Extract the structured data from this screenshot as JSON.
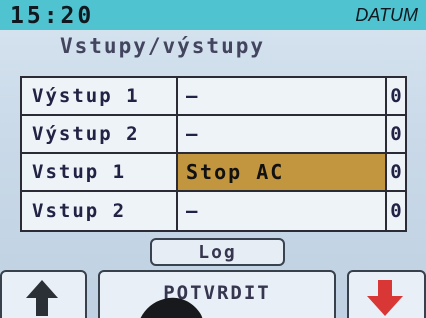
{
  "status_bar": {
    "time": "15:20",
    "date_label": "DATUM"
  },
  "page_title": "Vstupy/výstupy",
  "io_table": {
    "rows": [
      {
        "name": "Výstup 1",
        "value": "—",
        "count": "0",
        "active": false
      },
      {
        "name": "Výstup 2",
        "value": "—",
        "count": "0",
        "active": false
      },
      {
        "name": "Vstup 1",
        "value": "Stop AC",
        "count": "0",
        "active": true
      },
      {
        "name": "Vstup 2",
        "value": "—",
        "count": "0",
        "active": false
      }
    ]
  },
  "buttons": {
    "log": "Log",
    "confirm": "POTVRDIT",
    "up_icon": "up-arrow-icon",
    "down_icon": "down-arrow-icon"
  },
  "colors": {
    "status_bar": "#4fc3cf",
    "screen_bg": "#c9d9e8",
    "active_cell": "#c2953f",
    "up_arrow": "#2b2f36",
    "down_arrow": "#d93636"
  }
}
